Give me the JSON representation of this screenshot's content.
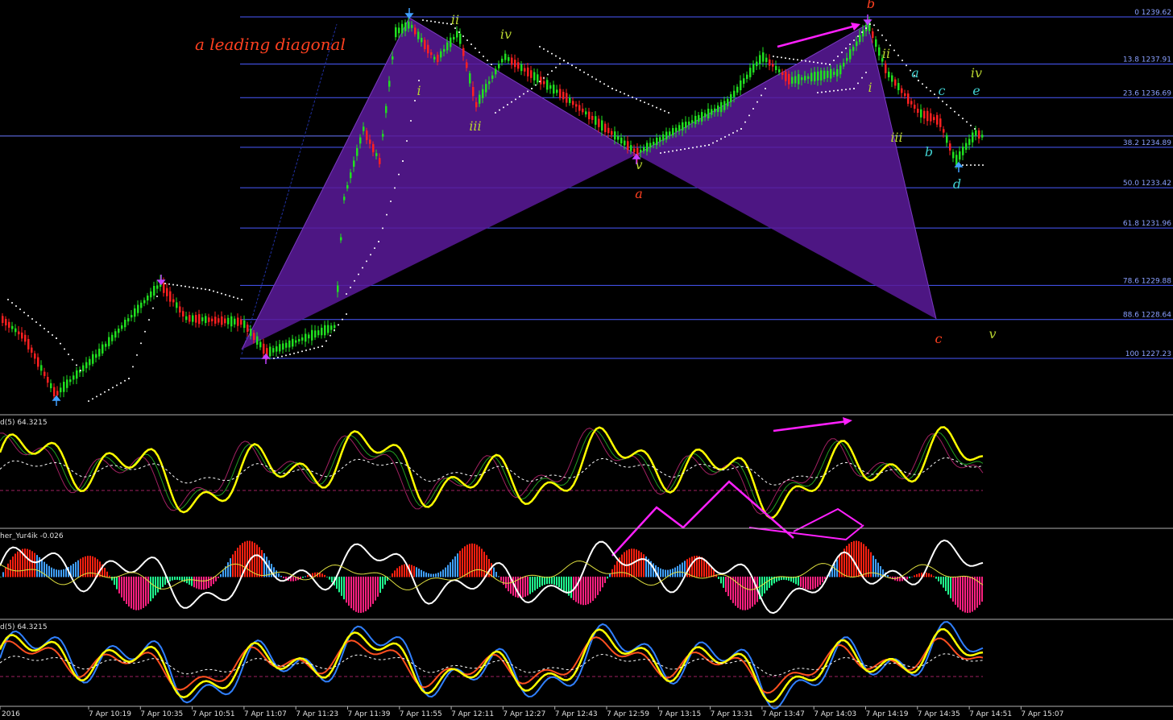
{
  "chart_data": {
    "type": "candlestick",
    "symbol_timeframe": "7 Apr 2016 intraday",
    "annotation_title": "a leading diagonal",
    "price_range": [
      1226.6,
      1239.9
    ],
    "fibonacci_levels": [
      {
        "label": "0 1239.62",
        "price": 1239.62
      },
      {
        "label": "13.8 1237.91",
        "price": 1237.91
      },
      {
        "label": "23.6 1236.69",
        "price": 1236.69
      },
      {
        "label": "38.2 1234.89",
        "price": 1234.89
      },
      {
        "label": "50.0 1233.42",
        "price": 1233.42
      },
      {
        "label": "61.8 1231.96",
        "price": 1231.96
      },
      {
        "label": "78.6 1229.88",
        "price": 1229.88
      },
      {
        "label": "88.6 1228.64",
        "price": 1228.64
      },
      {
        "label": "100 1227.23",
        "price": 1227.23
      }
    ],
    "current_price_line": 1235.3,
    "time_labels": [
      "2016",
      "7 Apr 10:19",
      "7 Apr 10:35",
      "7 Apr 10:51",
      "7 Apr 11:07",
      "7 Apr 11:23",
      "7 Apr 11:39",
      "7 Apr 11:55",
      "7 Apr 12:11",
      "7 Apr 12:27",
      "7 Apr 12:43",
      "7 Apr 12:59",
      "7 Apr 13:15",
      "7 Apr 13:31",
      "7 Apr 13:47",
      "7 Apr 14:03",
      "7 Apr 14:19",
      "7 Apr 14:35",
      "7 Apr 14:51",
      "7 Apr 15:07"
    ],
    "wave_labels": [
      {
        "text": "ii",
        "color": "#b8d430"
      },
      {
        "text": "iv",
        "color": "#b8d430"
      },
      {
        "text": "i",
        "color": "#b8d430"
      },
      {
        "text": "iii",
        "color": "#b8d430"
      },
      {
        "text": "v",
        "color": "#b8d430"
      },
      {
        "text": "a",
        "color": "#ff4020"
      },
      {
        "text": "b",
        "color": "#ff4020"
      },
      {
        "text": "c",
        "color": "#ff4020"
      },
      {
        "text": "ii",
        "color": "#b8d430"
      },
      {
        "text": "i",
        "color": "#b8d430"
      },
      {
        "text": "iii",
        "color": "#b8d430"
      },
      {
        "text": "a",
        "color": "#40d0d0"
      },
      {
        "text": "b",
        "color": "#40d0d0"
      },
      {
        "text": "c",
        "color": "#40d0d0"
      },
      {
        "text": "d",
        "color": "#40d0d0"
      },
      {
        "text": "e",
        "color": "#40d0d0"
      },
      {
        "text": "iv",
        "color": "#b8d430"
      },
      {
        "text": "v",
        "color": "#b8d430"
      }
    ],
    "harmonic_pattern": {
      "color": "#5a1a9a",
      "fill_opacity": 0.85
    },
    "indicator_panels": [
      {
        "title": "d(5) 64.3215",
        "type": "line",
        "color": "#ffff00"
      },
      {
        "title": "her_Yur4ik -0.026",
        "type": "histogram",
        "colors": [
          "#ff2010",
          "#40a0ff",
          "#20ff90",
          "#ff2080"
        ]
      },
      {
        "title": "d(5) 64.3215",
        "type": "line",
        "color": "#ffff00"
      }
    ],
    "colors": {
      "bull_candle": "#20e020",
      "bear_candle": "#ff2020",
      "fib_line": "#4a5aff",
      "psar": "#ffffff",
      "divergence_arrow": "#ff20ff"
    },
    "grid": false
  }
}
